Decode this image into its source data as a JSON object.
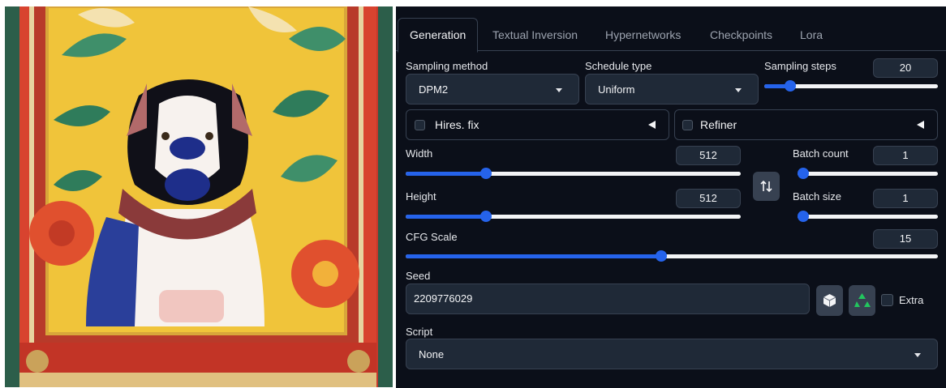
{
  "tabs": [
    {
      "label": "Generation",
      "active": true
    },
    {
      "label": "Textual Inversion",
      "active": false
    },
    {
      "label": "Hypernetworks",
      "active": false
    },
    {
      "label": "Checkpoints",
      "active": false
    },
    {
      "label": "Lora",
      "active": false
    }
  ],
  "sampling": {
    "method_label": "Sampling method",
    "method_value": "DPM2",
    "schedule_label": "Schedule type",
    "schedule_value": "Uniform",
    "steps_label": "Sampling steps",
    "steps_value": "20"
  },
  "hires": {
    "label": "Hires. fix",
    "checked": false
  },
  "refiner": {
    "label": "Refiner",
    "checked": false
  },
  "width": {
    "label": "Width",
    "value": "512"
  },
  "height": {
    "label": "Height",
    "value": "512"
  },
  "batch_count": {
    "label": "Batch count",
    "value": "1"
  },
  "batch_size": {
    "label": "Batch size",
    "value": "1"
  },
  "cfg": {
    "label": "CFG Scale",
    "value": "15"
  },
  "slider_levels": {
    "steps": 0.15,
    "width": 0.24,
    "height": 0.24,
    "batch_count": 0.0,
    "batch_size": 0.0,
    "cfg": 0.48
  },
  "seed": {
    "label": "Seed",
    "value": "2209776029",
    "extra_label": "Extra"
  },
  "script": {
    "label": "Script",
    "value": "None"
  },
  "icons": {
    "swap": "swap-dimensions-icon",
    "dice": "dice-icon",
    "recycle": "recycle-icon"
  },
  "colors": {
    "accent": "#2563eb",
    "panel_bg": "#0b0f19",
    "input_bg": "#1f2937",
    "recycle": "#22c55e"
  }
}
